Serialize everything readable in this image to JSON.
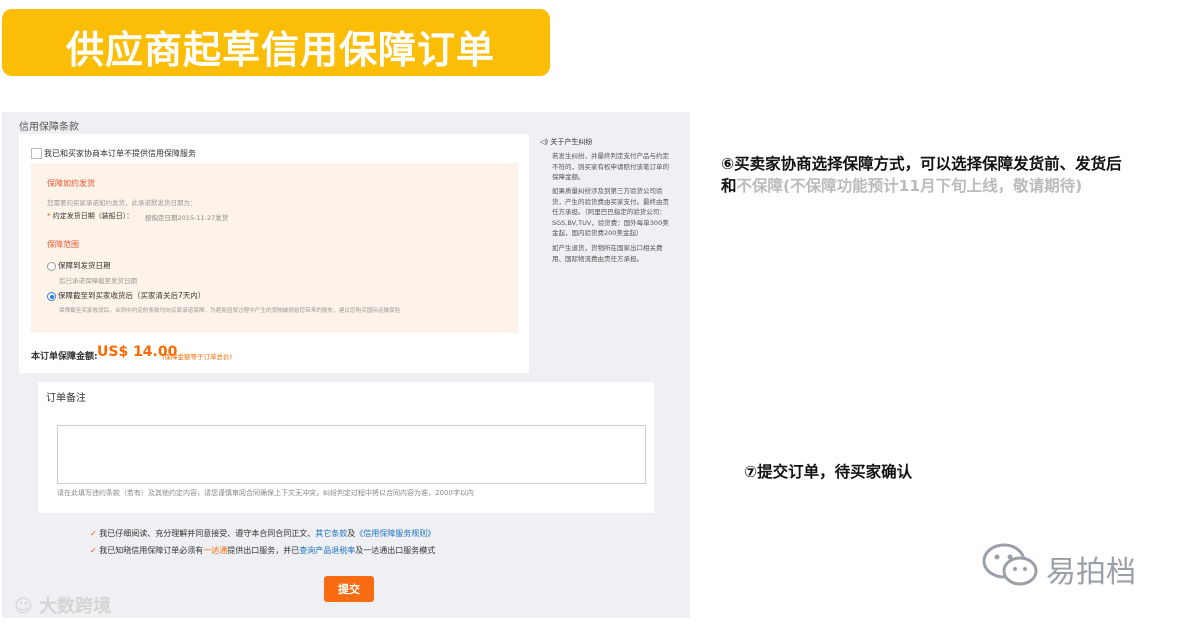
{
  "title": "供应商起草信用保障订单",
  "form": {
    "section_title": "信用保障条款",
    "opt_out_label": "我已和买家协商本订单不提供信用保障服务",
    "delivery_heading": "保障如约发货",
    "delivery_desc": "您需要向买家承诺如约发货，此承诺默发货日期为：",
    "delivery_date_label": "约定发货日期（装船日）：",
    "delivery_date_value": "按指定日期2015-11-27发货",
    "scope_heading": "保障范围",
    "option1_label": "保障到发货日期",
    "option1_desc": "后已承诺保障截至发货日期",
    "option2_label": "保障截至到买家收货后（买家清关后7天内）",
    "option2_desc": "保障截至买家收货后，合同中约定的条款均向买家承诺保障，为避免因贸过程中产生的货物破损给您带来的损失，建议您购买国际运输保险",
    "amount_label": "本订单保障金额:",
    "amount_value": "US$ 14.00",
    "amount_note": "(保障金额等于订单总价)",
    "side_heading": "关于产生纠纷",
    "side_p1": "若发生纠纷，并最终判定支付产品与约定不符的，则买家有权申请赔付该笔订单的保障金额。",
    "side_p2": "如果质量纠纷涉及到第三方验货公司验货，产生的验货费由买家支付。最终由责任方承担。（阿里巴巴指定的验货公司：SGS,BV,TUV，验货费：国外每单300美金起，国内验货费200美金起）",
    "side_p3": "如产生退货，货物所在国家出口相关费用、国际物流费由责任方承担。",
    "remark_title": "订单备注",
    "remark_hint": "请在此填写违约条款（若有）及其他约定内容，请您谨慎审阅合同确保上下文无冲突，纠纷判定过程中将以合同内容为准，2000字以内",
    "agree1_a": "我已仔细阅读、充分理解并同意接受、遵守本合同合同正文、",
    "agree1_link1": "其它条款",
    "agree1_b": "及",
    "agree1_link2": "《信用保障服务规则》",
    "agree2_a": "我已知晓信用保障订单必须有",
    "agree2_link1": "一达通",
    "agree2_b": "提供出口服务，并已",
    "agree2_link2": "查询产品退税率",
    "agree2_c": "及一达通出口服务模式",
    "submit_label": "提交"
  },
  "notes": {
    "step6_black": "⑥买卖家协商选择保障方式，可以选择保障发货前、发货后和",
    "step6_grey": "不保障(不保障功能预计11月下旬上线，敬请期待)",
    "step7": "⑦提交订单，待买家确认"
  },
  "branding": {
    "logo_text": "易拍档",
    "watermark": "大数跨境"
  },
  "colors": {
    "banner": "#fbbd05",
    "accent_orange": "#ff6a00",
    "link_blue": "#1a6fc2"
  }
}
